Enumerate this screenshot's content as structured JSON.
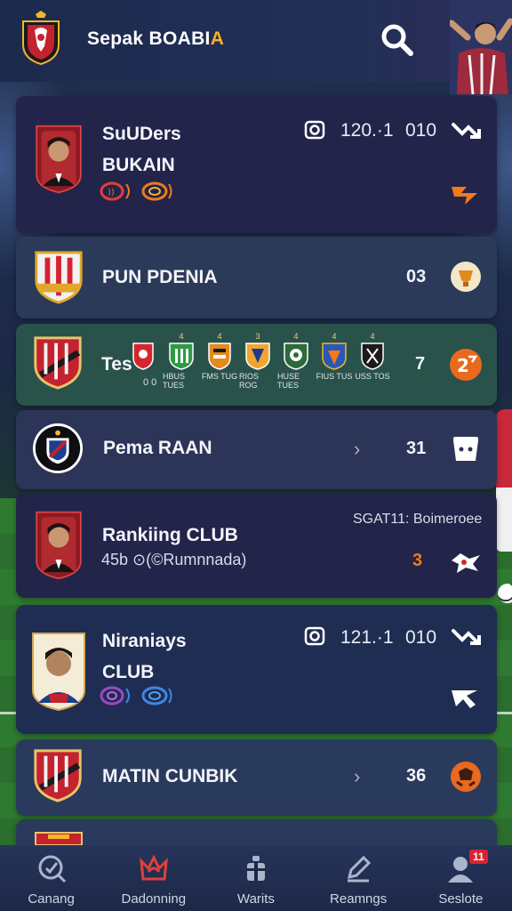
{
  "app": {
    "title_main": "Sepak BOABI",
    "title_accent": "A"
  },
  "colors": {
    "accent_orange": "#f07a1c",
    "header_bg": "#1c2a4d",
    "nav_bg": "#1d2848"
  },
  "cards": [
    {
      "name_line1": "SuUDers",
      "name_line2": "BUKAIN",
      "stat": "120.·1",
      "stat2": "010",
      "icons": [
        "camera-icon",
        "trend-down-icon",
        "flame-icon",
        "chip-icon",
        "chip-icon"
      ]
    },
    {
      "name": "PUN PDENIA",
      "value": "03",
      "icons": [
        "trophy-icon"
      ]
    },
    {
      "name": "Tes",
      "sub": "0 0",
      "value": "7",
      "icons": [
        "score-icon"
      ],
      "mini_badges": [
        {
          "tag": "",
          "lab": ""
        },
        {
          "tag": "4",
          "lab": "HBUS TUES"
        },
        {
          "tag": "4",
          "lab": "FMS TUG"
        },
        {
          "tag": "3",
          "lab": "RIOS ROG"
        },
        {
          "tag": "4",
          "lab": "HUSE TUES"
        },
        {
          "tag": "4",
          "lab": "FIUS TUS"
        },
        {
          "tag": "4",
          "lab": "USS TOS"
        }
      ]
    },
    {
      "name": "Pema RAAN",
      "value": "31",
      "icons": [
        "chevron-right-icon",
        "bucket-icon"
      ]
    },
    {
      "name": "Rankiing CLUB",
      "sub": "45b  ⊙(©Rumnnada)",
      "meta": "SGAT11: Boimeroee",
      "value": "3",
      "icons": [
        "shield-star-icon"
      ]
    },
    {
      "name_line1": "Niraniays",
      "name_line2": "CLUB",
      "stat": "121.·1",
      "stat2": "010",
      "icons": [
        "camera-icon",
        "trend-down-icon",
        "trend-up-icon"
      ]
    },
    {
      "name": "MATIN CUNBIK",
      "value": "36",
      "icons": [
        "chevron-right-icon",
        "ball-icon"
      ]
    }
  ],
  "nav": [
    {
      "label": "Canang",
      "icon": "search-icon"
    },
    {
      "label": "Dadonning",
      "icon": "fire-icon"
    },
    {
      "label": "Warits",
      "icon": "gift-icon"
    },
    {
      "label": "Reamngs",
      "icon": "pencil-icon"
    },
    {
      "label": "Seslote",
      "icon": "profile-icon",
      "badge": "11"
    }
  ]
}
